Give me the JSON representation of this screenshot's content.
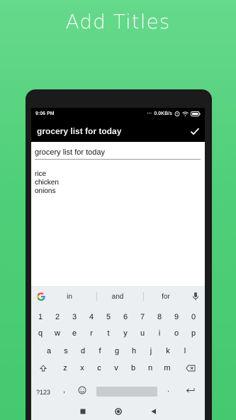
{
  "promo": {
    "title": "Add Titles"
  },
  "status_bar": {
    "time": "9:06 PM",
    "network_speed": "0.0KB/s"
  },
  "app_bar": {
    "title": "grocery list for today",
    "confirm_icon": "check-icon"
  },
  "editor": {
    "title_value": "grocery list for today",
    "body_lines": [
      "rice",
      "chicken",
      "onions"
    ]
  },
  "keyboard": {
    "suggestions": [
      "in",
      "and",
      "for"
    ],
    "rows": [
      [
        "1",
        "2",
        "3",
        "4",
        "5",
        "6",
        "7",
        "8",
        "9",
        "0"
      ],
      [
        "q",
        "w",
        "e",
        "r",
        "t",
        "y",
        "u",
        "i",
        "o",
        "p"
      ],
      [
        "a",
        "s",
        "d",
        "f",
        "g",
        "h",
        "j",
        "k",
        "l"
      ],
      [
        "z",
        "x",
        "c",
        "v",
        "b",
        "n",
        "m"
      ]
    ],
    "symbols_key": "?123",
    "comma_key": ",",
    "period_key": "."
  },
  "colors": {
    "background_green": "#4fcf79",
    "app_bar": "#000000",
    "keyboard": "#eceff1"
  }
}
